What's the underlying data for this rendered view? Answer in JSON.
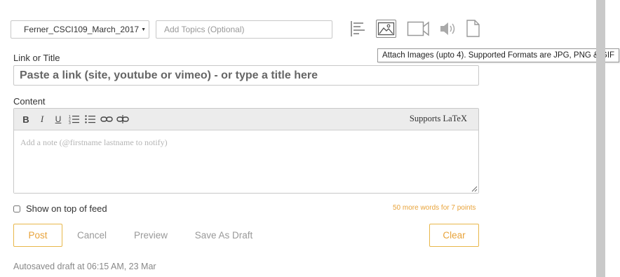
{
  "course_select": {
    "value": "Ferner_CSCI109_March_2017"
  },
  "topics": {
    "placeholder": "Add Topics (Optional)"
  },
  "media_icons": [
    {
      "name": "text-align-icon"
    },
    {
      "name": "image-icon",
      "active": true
    },
    {
      "name": "video-icon"
    },
    {
      "name": "audio-icon"
    },
    {
      "name": "file-icon"
    }
  ],
  "tooltip": {
    "text": "Attach Images (upto 4). Supported Formats are JPG, PNG & GIF"
  },
  "link_title": {
    "label": "Link or Title",
    "placeholder": "Paste a link (site, youtube or vimeo) - or type a title here"
  },
  "content": {
    "label": "Content",
    "toolbar": {
      "bold": "B",
      "italic": "I",
      "underline": "U",
      "latex": "Supports LaTeX"
    },
    "placeholder": "Add a note (@firstname lastname to notify)"
  },
  "show_on_top": {
    "label": "Show on top of feed",
    "checked": false
  },
  "points_hint": "50 more words for 7 points",
  "actions": {
    "post": "Post",
    "cancel": "Cancel",
    "preview": "Preview",
    "save_draft": "Save As Draft",
    "clear": "Clear"
  },
  "autosave": "Autosaved draft at 06:15 AM, 23 Mar",
  "colors": {
    "accent": "#e8a33a",
    "border": "#c8c8c8",
    "icon": "#999999"
  }
}
